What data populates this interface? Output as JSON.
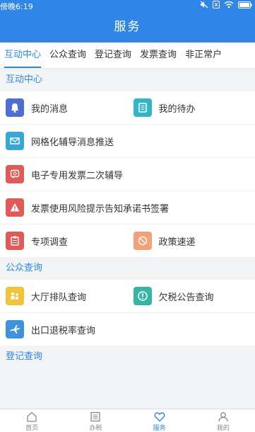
{
  "statusbar": {
    "time": "傍晚6:19"
  },
  "appbar": {
    "title": "服务"
  },
  "tabs": [
    {
      "label": "互动中心",
      "active": true
    },
    {
      "label": "公众查询"
    },
    {
      "label": "登记查询"
    },
    {
      "label": "发票查询"
    },
    {
      "label": "非正常户"
    }
  ],
  "sections": {
    "interaction": {
      "title": "互动中心",
      "items": {
        "my_messages": {
          "label": "我的消息",
          "icon": "bell-icon",
          "color": "#4f6ed3"
        },
        "my_todo": {
          "label": "我的待办",
          "icon": "document-icon",
          "color": "#31b5c9"
        },
        "grid_push": {
          "label": "网格化辅导消息推送",
          "icon": "envelope-icon",
          "color": "#38a7d6"
        },
        "e_invoice": {
          "label": "电子专用发票二次辅导",
          "icon": "invoice-chat-icon",
          "color": "#e05a57"
        },
        "risk_notice": {
          "label": "发票使用风险提示告知承诺书签署",
          "icon": "warning-icon",
          "color": "#e05a57"
        },
        "special_survey": {
          "label": "专项调查",
          "icon": "clipboard-icon",
          "color": "#e05a57"
        },
        "policy_express": {
          "label": "政策速递",
          "icon": "policy-icon",
          "color": "#f4a078"
        }
      }
    },
    "public": {
      "title": "公众查询",
      "items": {
        "hall_queue": {
          "label": "大厅排队查询",
          "icon": "queue-icon",
          "color": "#f2c23a"
        },
        "tax_arrears": {
          "label": "欠税公告查询",
          "icon": "exclamation-icon",
          "color": "#36b4a7"
        },
        "export_rebate": {
          "label": "出口退税率查询",
          "icon": "airplane-icon",
          "color": "#3e91dc"
        }
      }
    },
    "registration": {
      "title": "登记查询"
    }
  },
  "bottomnav": [
    {
      "label": "首页",
      "icon": "home-icon"
    },
    {
      "label": "办税",
      "icon": "list-icon"
    },
    {
      "label": "服务",
      "icon": "heart-icon",
      "active": true
    },
    {
      "label": "我的",
      "icon": "user-icon"
    }
  ]
}
